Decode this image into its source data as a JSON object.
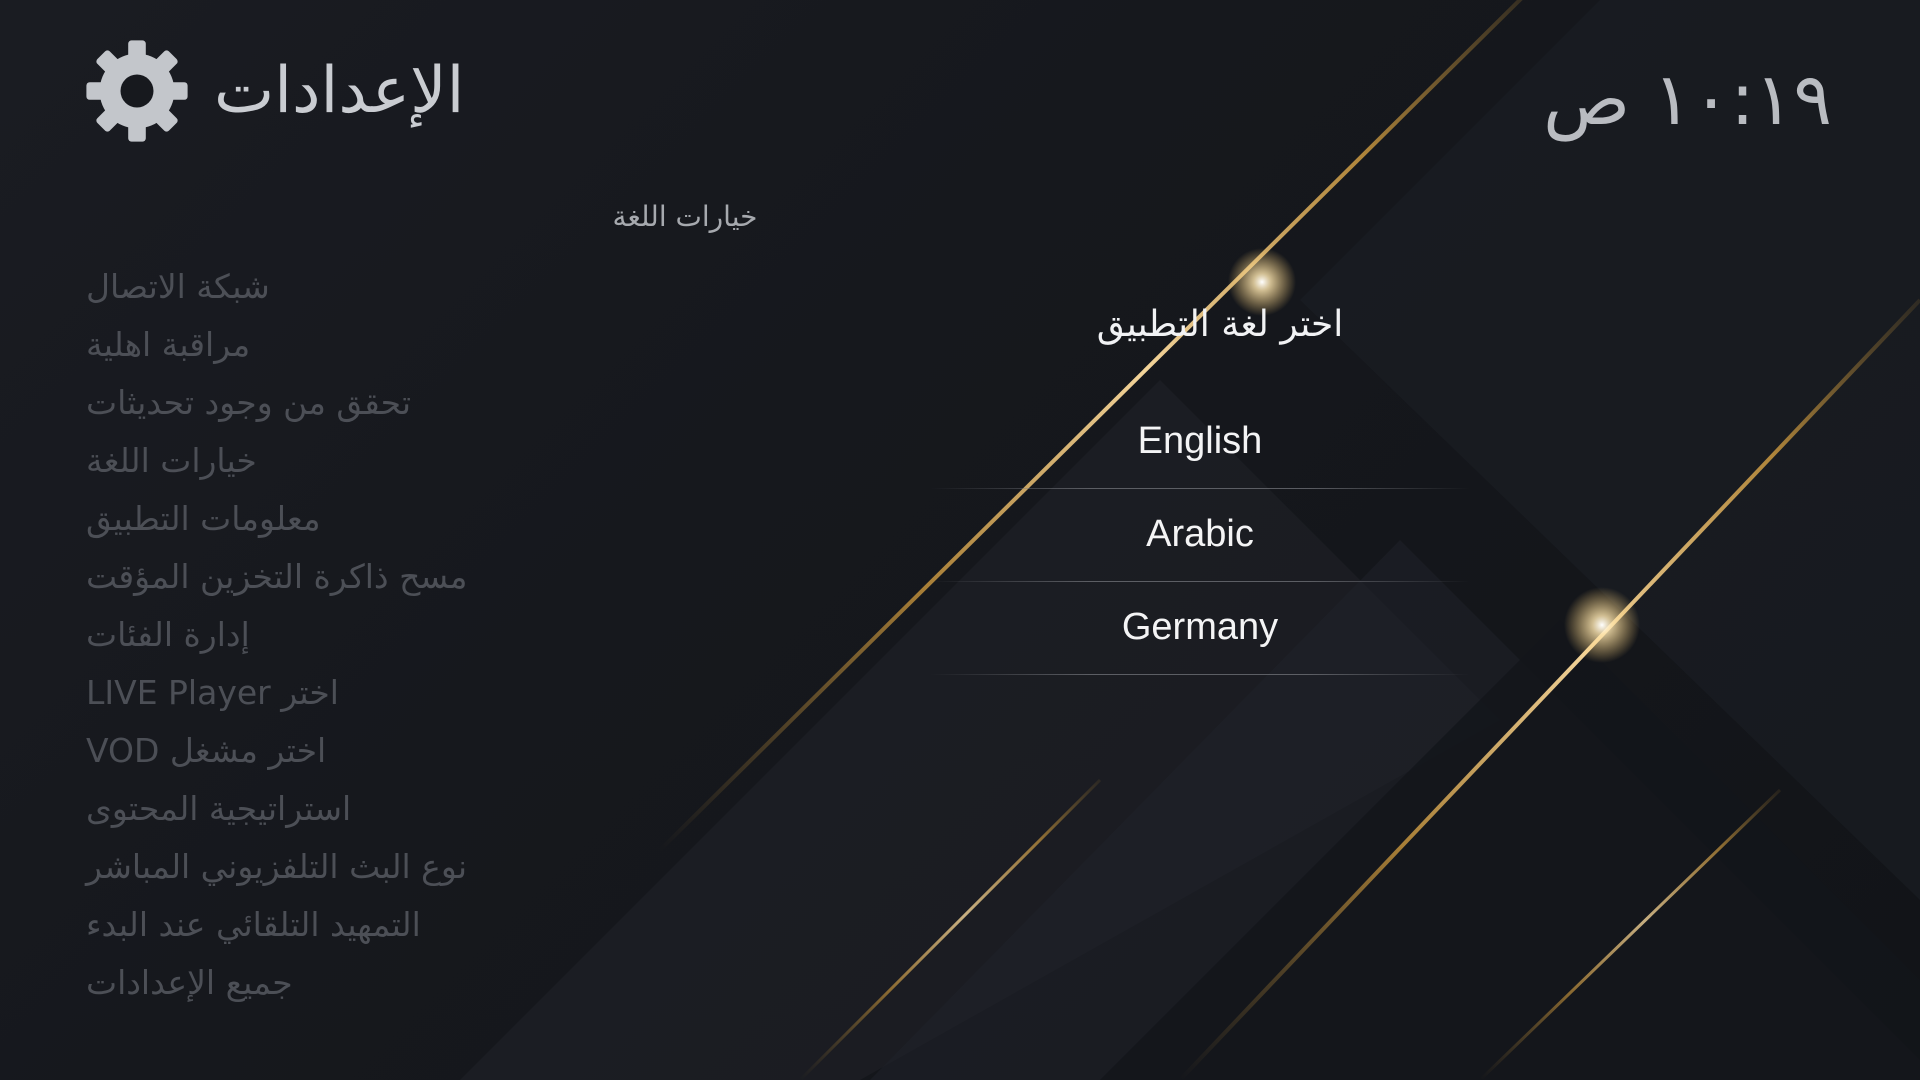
{
  "header": {
    "title": "الإعدادات",
    "clock": "١٠:١٩ ص"
  },
  "sidebar": {
    "items": [
      {
        "label": "شبكة الاتصال"
      },
      {
        "label": "مراقبة اهلية"
      },
      {
        "label": "تحقق من وجود تحديثات"
      },
      {
        "label": "خيارات اللغة"
      },
      {
        "label": "معلومات التطبيق"
      },
      {
        "label": "مسح ذاكرة التخزين المؤقت"
      },
      {
        "label": "إدارة الفئات"
      },
      {
        "label": "اختر LIVE Player"
      },
      {
        "label": "اختر مشغل VOD"
      },
      {
        "label": "استراتيجية المحتوى"
      },
      {
        "label": "نوع البث التلفزيوني المباشر"
      },
      {
        "label": "التمهيد التلقائي عند البدء"
      },
      {
        "label": "جميع الإعدادات"
      }
    ]
  },
  "section": {
    "title": "خيارات اللغة"
  },
  "dialog": {
    "title": "اختر لغة التطبيق",
    "options": [
      {
        "label": "English"
      },
      {
        "label": "Arabic"
      },
      {
        "label": "Germany"
      }
    ]
  },
  "colors": {
    "background": "#15171c",
    "accent_gold": "#d4a24a",
    "menu_text": "#4c4f56",
    "title_text": "#c9ccd1"
  },
  "icons": {
    "settings": "gear-icon"
  }
}
